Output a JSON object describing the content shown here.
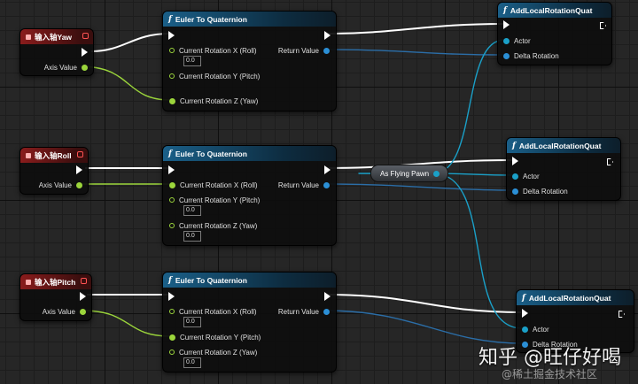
{
  "events": [
    {
      "title": "输入轴Yaw",
      "pin_label": "Axis Value"
    },
    {
      "title": "输入轴Roll",
      "pin_label": "Axis Value"
    },
    {
      "title": "输入轴Pitch",
      "pin_label": "Axis Value"
    }
  ],
  "euler_nodes": [
    {
      "title": "Euler To Quaternion",
      "pin_x": "Current Rotation X (Roll)",
      "pin_y": "Current Rotation Y (Pitch)",
      "pin_z": "Current Rotation Z (Yaw)",
      "val_x": "0.0",
      "val_y": "",
      "val_z": "",
      "output": "Return Value"
    },
    {
      "title": "Euler To Quaternion",
      "pin_x": "Current Rotation X (Roll)",
      "pin_y": "Current Rotation Y (Pitch)",
      "pin_z": "Current Rotation Z (Yaw)",
      "val_x": "",
      "val_y": "0.0",
      "val_z": "0.0",
      "output": "Return Value"
    },
    {
      "title": "Euler To Quaternion",
      "pin_x": "Current Rotation X (Roll)",
      "pin_y": "Current Rotation Y (Pitch)",
      "pin_z": "Current Rotation Z (Yaw)",
      "val_x": "0.0",
      "val_y": "",
      "val_z": "0.0",
      "output": "Return Value"
    }
  ],
  "add_nodes": [
    {
      "title": "AddLocalRotationQuat",
      "pin_actor": "Actor",
      "pin_delta": "Delta Rotation"
    },
    {
      "title": "AddLocalRotationQuat",
      "pin_actor": "Actor",
      "pin_delta": "Delta Rotation"
    },
    {
      "title": "AddLocalRotationQuat",
      "pin_actor": "Actor",
      "pin_delta": "Delta Rotation"
    }
  ],
  "cast_node": {
    "label": "As Flying Pawn"
  },
  "watermark": {
    "main": "知乎 @旺仔好喝",
    "sub": "@稀土掘金技术社区"
  },
  "colors": {
    "exec_wire": "#ffffff",
    "float_wire": "#9bd53b",
    "struct_wire": "#2b8fd6",
    "object_wire": "#1aa0c8"
  }
}
